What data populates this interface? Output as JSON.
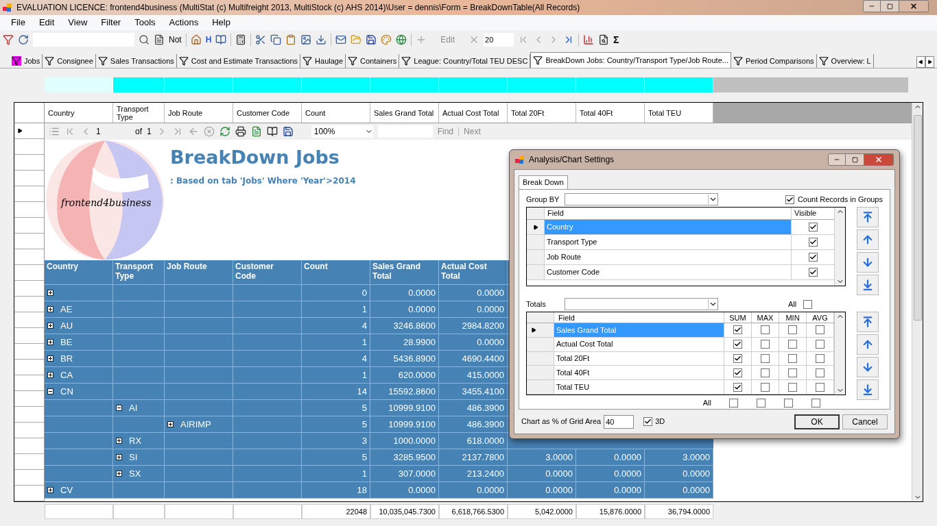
{
  "window": {
    "title": "EVALUATION LICENCE: frontend4business (MultiStat (c) Multifreight 2013, MultiStock (c) AHS 2014)\\User = dennis\\Form = BreakDownTable(All Records)"
  },
  "menu": [
    "File",
    "Edit",
    "View",
    "Filter",
    "Tools",
    "Actions",
    "Help"
  ],
  "toolbar": {
    "not_label": "Not",
    "h_label": "H",
    "edit": {
      "label": "Edit",
      "disabled": true
    },
    "page_size": "20",
    "sigma": "Σ"
  },
  "tabs": [
    {
      "label": "Jobs",
      "selected": false,
      "highlighted": true
    },
    {
      "label": "Consignee",
      "selected": false,
      "highlighted": false
    },
    {
      "label": "Sales Transactions",
      "selected": false,
      "highlighted": false
    },
    {
      "label": "Cost and Estimate Transactions",
      "selected": false,
      "highlighted": false
    },
    {
      "label": "Haulage",
      "selected": false,
      "highlighted": false
    },
    {
      "label": "Containers",
      "selected": false,
      "highlighted": false
    },
    {
      "label": "League: Country/Total TEU DESC",
      "selected": false,
      "highlighted": false
    },
    {
      "label": "BreakDown Jobs: Country/Transport Type/Job Route...",
      "selected": true,
      "highlighted": false
    },
    {
      "label": "Period Comparisons",
      "selected": false,
      "highlighted": false
    },
    {
      "label": "Overview: L",
      "selected": false,
      "highlighted": false
    }
  ],
  "filter_cells": [
    {
      "selected": true
    },
    {
      "selected": false
    },
    {
      "selected": false
    },
    {
      "selected": false
    },
    {
      "selected": false
    },
    {
      "selected": false
    },
    {
      "selected": false
    },
    {
      "selected": false
    },
    {
      "selected": false
    },
    {
      "selected": false
    }
  ],
  "grid": {
    "columns": [
      "Country",
      "Transport Type",
      "Job Route",
      "Customer Code",
      "Count",
      "Sales Grand Total",
      "Actual Cost Total",
      "Total 20Ft",
      "Total 40Ft",
      "Total TEU"
    ]
  },
  "report_toolbar": {
    "page": "1",
    "of_label": "of",
    "page_count": "1",
    "zoom": "100%",
    "find": "Find",
    "next": "Next"
  },
  "report": {
    "logo_text": "frontend4business",
    "title": "BreakDown Jobs",
    "subtitle": ": Based on tab 'Jobs' Where 'Year'>2014",
    "columns": [
      "Country",
      "Transport Type",
      "Job Route",
      "Customer Code",
      "Count",
      "Sales Grand Total",
      "Actual Cost Total"
    ],
    "rows": [
      {
        "expanded": false,
        "cells": [
          "0",
          "0.0000",
          "0.0000"
        ]
      },
      {
        "label": "AE",
        "expanded": false,
        "cells": [
          "1",
          "0.0000",
          "0.0000"
        ]
      },
      {
        "label": "AU",
        "expanded": false,
        "cells": [
          "4",
          "3246.8600",
          "2984.8200"
        ]
      },
      {
        "label": "BE",
        "expanded": false,
        "cells": [
          "1",
          "28.9900",
          "0.0000"
        ]
      },
      {
        "label": "BR",
        "expanded": false,
        "cells": [
          "4",
          "5436.8900",
          "4690.4400"
        ]
      },
      {
        "label": "CA",
        "expanded": false,
        "cells": [
          "1",
          "620.0000",
          "415.0000"
        ]
      },
      {
        "label": "CN",
        "expanded": true,
        "cells": [
          "14",
          "15592.8600",
          "3455.4100"
        ],
        "children": [
          {
            "label": "AI",
            "expanded": true,
            "cells": [
              "5",
              "10999.9100",
              "486.3900"
            ],
            "children": [
              {
                "label": "AIRIMP",
                "expanded": false,
                "cells": [
                  "5",
                  "10999.9100",
                  "486.3900"
                ]
              }
            ]
          },
          {
            "label": "RX",
            "expanded": false,
            "cells": [
              "3",
              "1000.0000",
              "618.0000"
            ]
          },
          {
            "label": "SI",
            "expanded": false,
            "cells": [
              "5",
              "3285.9500",
              "2137.7800",
              "3.0000",
              "0.0000",
              "3.0000"
            ]
          },
          {
            "label": "SX",
            "expanded": false,
            "cells": [
              "1",
              "307.0000",
              "213.2400",
              "0.0000",
              "0.0000",
              "0.0000"
            ]
          }
        ]
      },
      {
        "label": "CV",
        "expanded": false,
        "cells": [
          "18",
          "0.0000",
          "0.0000",
          "0.0000",
          "0.0000",
          "0.0000"
        ]
      }
    ]
  },
  "totals": [
    "22048",
    "10,035,045.7300",
    "6,618,766.5300",
    "5,042.0000",
    "15,876.0000",
    "36,794.0000"
  ],
  "dialog": {
    "title": "Analysis/Chart Settings",
    "tabs": [
      {
        "label": "Break Down",
        "selected": true
      }
    ],
    "group_by_label": "Group BY",
    "count_records": {
      "label": "Count Records in Groups",
      "checked": true
    },
    "group_grid": {
      "columns": [
        "Field",
        "Visible"
      ],
      "rows": [
        {
          "field": "Country",
          "visible": true,
          "selected": true
        },
        {
          "field": "Transport Type",
          "visible": true,
          "selected": false
        },
        {
          "field": "Job Route",
          "visible": true,
          "selected": false
        },
        {
          "field": "Customer Code",
          "visible": true,
          "selected": false
        }
      ]
    },
    "totals_label": "Totals",
    "all_label": "All",
    "all_checked": false,
    "totals_grid": {
      "columns": [
        "Field",
        "SUM",
        "MAX",
        "MIN",
        "AVG"
      ],
      "rows": [
        {
          "field": "Sales Grand Total",
          "checks": [
            true,
            false,
            false,
            false
          ],
          "selected": true
        },
        {
          "field": "Actual Cost Total",
          "checks": [
            true,
            false,
            false,
            false
          ],
          "selected": false
        },
        {
          "field": "Total 20Ft",
          "checks": [
            true,
            false,
            false,
            false
          ],
          "selected": false
        },
        {
          "field": "Total 40Ft",
          "checks": [
            true,
            false,
            false,
            false
          ],
          "selected": false
        },
        {
          "field": "Total TEU",
          "checks": [
            true,
            false,
            false,
            false
          ],
          "selected": false
        }
      ]
    },
    "all_row": {
      "label": "All",
      "checks": [
        false,
        false,
        false,
        false
      ]
    },
    "chart_pct": {
      "label": "Chart as % of Grid Area",
      "value": "40"
    },
    "three_d": {
      "label": "3D",
      "checked": true
    },
    "buttons": [
      "OK",
      "Cancel"
    ]
  }
}
